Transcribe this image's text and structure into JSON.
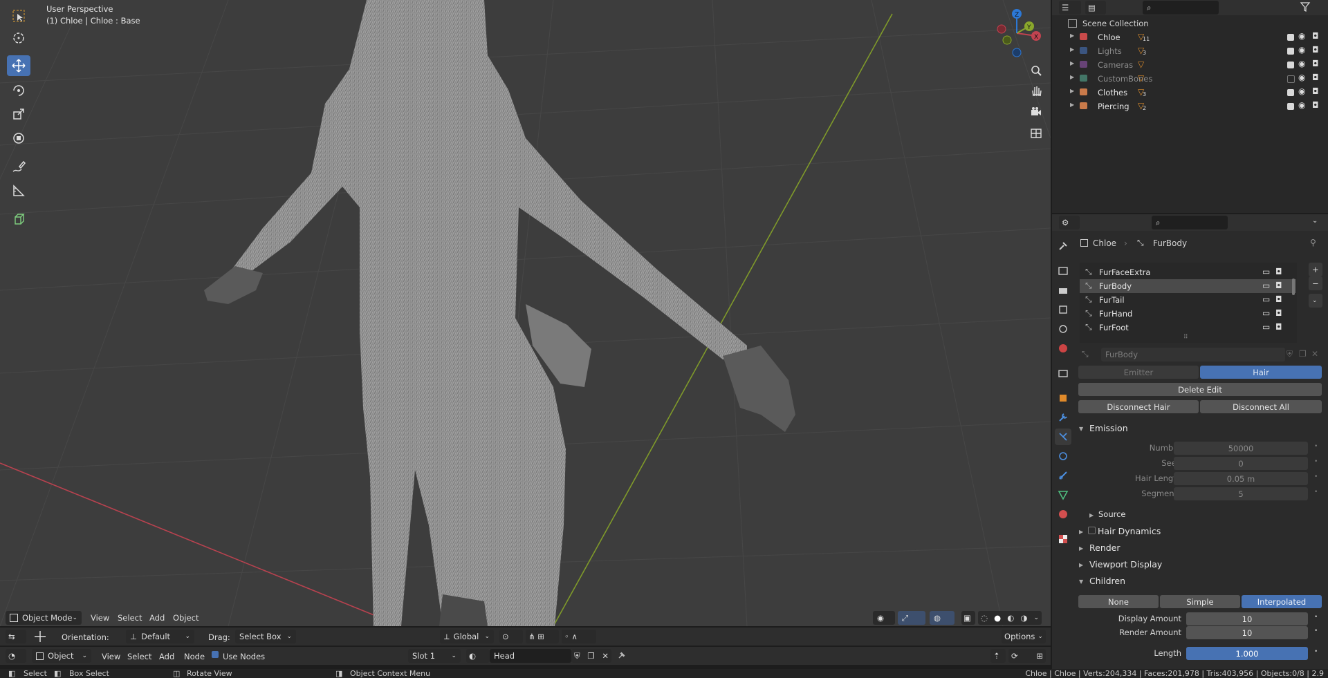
{
  "viewport": {
    "perspective_label": "User Perspective",
    "object_label": "(1) Chloe | Chloe : Base"
  },
  "header": {
    "mode": "Object Mode",
    "menus": [
      "View",
      "Select",
      "Add",
      "Object"
    ]
  },
  "tool_settings": {
    "orientation_label": "Orientation:",
    "orientation_value": "Default",
    "drag_label": "Drag:",
    "drag_value": "Select Box",
    "transform_space": "Global",
    "options_label": "Options"
  },
  "node_header": {
    "object_value": "Object",
    "menus": [
      "View",
      "Select",
      "Add",
      "Node"
    ],
    "use_nodes_label": "Use Nodes",
    "slot_value": "Slot 1",
    "material_value": "Head"
  },
  "outliner": {
    "root": "Scene Collection",
    "items": [
      {
        "name": "Chloe",
        "badge": "11",
        "active": true,
        "visible": true
      },
      {
        "name": "Lights",
        "badge": "3",
        "active": false,
        "visible": true
      },
      {
        "name": "Cameras",
        "badge": "",
        "active": false,
        "visible": true
      },
      {
        "name": "CustomBones",
        "badge": "",
        "active": false,
        "visible": false
      },
      {
        "name": "Clothes",
        "badge": "3",
        "active": true,
        "visible": true
      },
      {
        "name": "Piercing",
        "badge": "2",
        "active": true,
        "visible": true
      }
    ]
  },
  "properties": {
    "breadcrumb_object": "Chloe",
    "breadcrumb_system": "FurBody",
    "particle_systems": [
      "FurFaceExtra",
      "FurBody",
      "FurTail",
      "FurHand",
      "FurFoot"
    ],
    "selected_system": "FurBody",
    "settings_name": "FurBody",
    "type_emitter": "Emitter",
    "type_hair": "Hair",
    "delete_edit": "Delete Edit",
    "disconnect_hair": "Disconnect Hair",
    "disconnect_all": "Disconnect All",
    "emission_title": "Emission",
    "emission_fields": [
      {
        "label": "Number",
        "value": "50000"
      },
      {
        "label": "Seed",
        "value": "0"
      },
      {
        "label": "Hair Length",
        "value": "0.05 m"
      },
      {
        "label": "Segments",
        "value": "5"
      }
    ],
    "source_label": "Source",
    "hair_dynamics_label": "Hair Dynamics",
    "render_label": "Render",
    "viewport_display_label": "Viewport Display",
    "children_title": "Children",
    "children_none": "None",
    "children_simple": "Simple",
    "children_interpolated": "Interpolated",
    "display_amount_label": "Display Amount",
    "display_amount_value": "10",
    "render_amount_label": "Render Amount",
    "render_amount_value": "10",
    "length_label": "Length",
    "length_value": "1.000",
    "length_fraction": 1.0
  },
  "statusbar": {
    "select": "Select",
    "box_select": "Box Select",
    "rotate_view": "Rotate View",
    "context_menu": "Object Context Menu",
    "stats": "Chloe | Chloe | Verts:204,334 | Faces:201,978 | Tris:403,956 | Objects:0/8 | 2.9"
  },
  "colors": {
    "accent": "#4772b3",
    "viewport_bg": "#3d3d3d",
    "panel_bg": "#2b2b2b",
    "x_axis": "#c14350",
    "y_axis": "#8aa72c"
  }
}
